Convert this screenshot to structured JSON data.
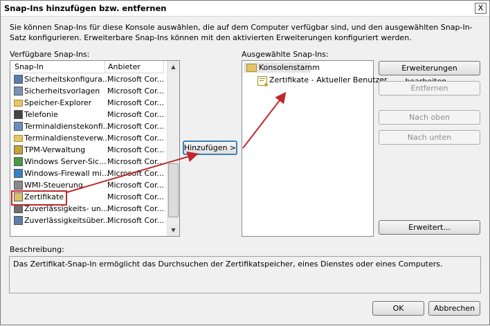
{
  "title": "Snap-Ins hinzufügen bzw. entfernen",
  "close_label": "X",
  "description": "Sie können Snap-Ins für diese Konsole auswählen, die auf dem Computer verfügbar sind, und den ausgewählten Snap-In-Satz konfigurieren. Erweiterbare Snap-Ins können mit den aktivierten Erweiterungen konfiguriert werden.",
  "available": {
    "label": "Verfügbare Snap-Ins:",
    "col_snapin": "Snap-In",
    "col_vendor": "Anbieter",
    "items": [
      {
        "name": "Sicherheitskonfigura...",
        "vendor": "Microsoft Cor...",
        "icon": "security-config-icon"
      },
      {
        "name": "Sicherheitsvorlagen",
        "vendor": "Microsoft Cor...",
        "icon": "security-template-icon"
      },
      {
        "name": "Speicher-Explorer",
        "vendor": "Microsoft Cor...",
        "icon": "folder-icon"
      },
      {
        "name": "Telefonie",
        "vendor": "Microsoft Cor...",
        "icon": "telephony-icon"
      },
      {
        "name": "Terminaldienstekonfi...",
        "vendor": "Microsoft Cor...",
        "icon": "terminal-config-icon"
      },
      {
        "name": "Terminaldiensteverw...",
        "vendor": "Microsoft Cor...",
        "icon": "folder-icon"
      },
      {
        "name": "TPM-Verwaltung",
        "vendor": "Microsoft Cor...",
        "icon": "tpm-icon"
      },
      {
        "name": "Windows Server-Sic...",
        "vendor": "Microsoft Cor...",
        "icon": "server-backup-icon"
      },
      {
        "name": "Windows-Firewall mi...",
        "vendor": "Microsoft Cor...",
        "icon": "firewall-icon"
      },
      {
        "name": "WMI-Steuerung",
        "vendor": "Microsoft Cor...",
        "icon": "wmi-icon"
      },
      {
        "name": "Zertifikate",
        "vendor": "Microsoft Cor...",
        "icon": "certificate-icon"
      },
      {
        "name": "Zuverlässigkeits- un...",
        "vendor": "Microsoft Cor...",
        "icon": "reliability-icon"
      },
      {
        "name": "Zuverlässigkeitsüber...",
        "vendor": "Microsoft Cor...",
        "icon": "reliability-monitor-icon"
      }
    ],
    "highlighted_index": 10
  },
  "add_button": "Hinzufügen >",
  "selected": {
    "label": "Ausgewählte Snap-Ins:",
    "root": "Konsolenstamm",
    "child": "Zertifikate - Aktueller Benutzer"
  },
  "side_buttons": {
    "edit_extensions": "Erweiterungen bearbeiten...",
    "remove": "Entfernen",
    "move_up": "Nach oben",
    "move_down": "Nach unten",
    "advanced": "Erweitert..."
  },
  "description_box": {
    "label": "Beschreibung:",
    "text": "Das Zertifikat-Snap-In ermöglicht das Durchsuchen der Zertifikatspeicher, eines Dienstes oder eines Computers."
  },
  "ok": "OK",
  "cancel": "Abbrechen",
  "colors": {
    "highlight_border": "#c0282a",
    "arrow": "#c0282a"
  }
}
